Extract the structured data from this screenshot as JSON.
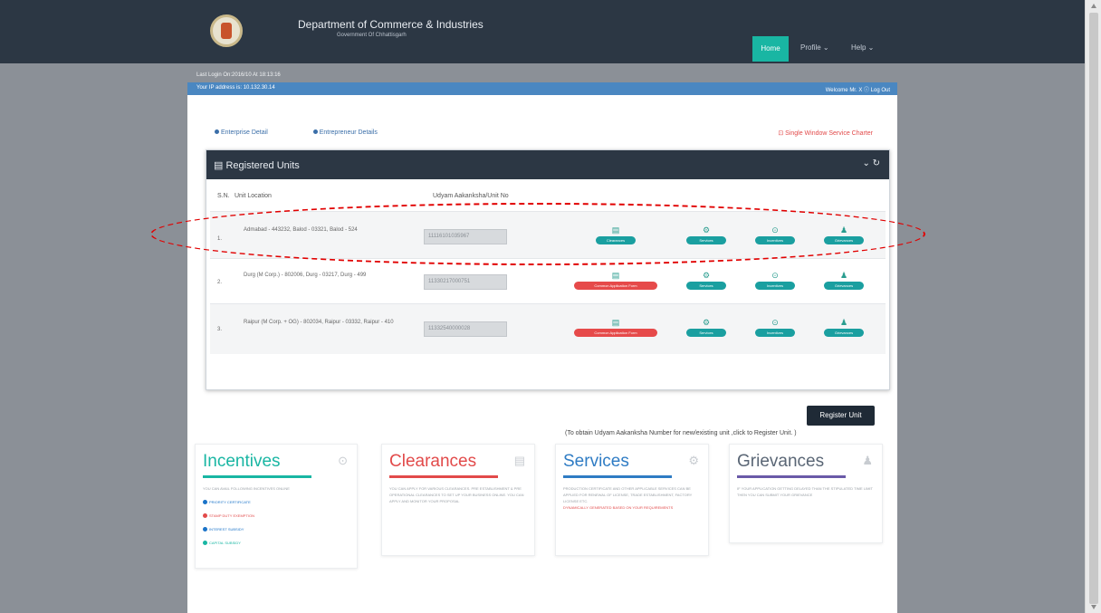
{
  "header": {
    "dept_title": "Department of Commerce & Industries",
    "dept_sub": "Government Of Chhattisgarh",
    "nav": {
      "home": "Home",
      "profile": "Profile ⌄",
      "help": "Help ⌄"
    }
  },
  "session": {
    "last_login": "Last Login On:2016/10 At 18:13:16",
    "ip": "Your IP address is: 10.132.30.14",
    "welcome": "Welcome Mr. X ⓘ Log Out"
  },
  "tabs": {
    "enterprise": "Enterprise Detail",
    "entrepreneur": "Entrepreneur Details",
    "charter": "Single Window Service Charter"
  },
  "units": {
    "heading": "Registered Units",
    "col_sn": "S.N.",
    "col_loc": "Unit Location",
    "col_udyam": "Udyam Aakanksha/Unit No",
    "rows": [
      {
        "sn": "1.",
        "location": "Admabad - 443232, Balod - 03321, Balod - 524",
        "udyam": "11116101035967",
        "act1": "Clearances",
        "act2": "Services",
        "act3": "Incentives",
        "act4": "Grievances"
      },
      {
        "sn": "2.",
        "location": "Durg (M Corp.) - 802006, Durg - 03217, Durg - 499",
        "udyam": "11330217000751",
        "act1": "Common Application Form",
        "act2": "Services",
        "act3": "Incentives",
        "act4": "Grievances"
      },
      {
        "sn": "3.",
        "location": "Raipur (M Corp. + OG) - 802034, Raipur - 03332, Raipur - 410",
        "udyam": "11332540000028",
        "act1": "Common Application Form",
        "act2": "Services",
        "act3": "Incentives",
        "act4": "Grievances"
      }
    ]
  },
  "register": {
    "button": "Register Unit",
    "note": "(To obtain Udyam Aakanksha Number for new/existing unit ,click to Register Unit. )"
  },
  "cards": {
    "incentives": {
      "title": "Incentives",
      "text": "YOU CAN AVAIL FOLLOWING INCENTIVES ONLINE",
      "links": [
        "PRIORITY CERTIFICATE",
        "STAMP DUTY EXEMPTION",
        "INTEREST SUBSIDY",
        "CAPITAL SUBSIDY"
      ]
    },
    "clearances": {
      "title": "Clearances",
      "text": "YOU CAN APPLY FOR VARIOUS CLEARANCES. PRE ESTABLISHMENT & PRE OPERATIONAL CLEARANCES TO SET UP YOUR BUSINESS ONLINE. YOU CAN APPLY AND MONITOR YOUR PROPOSAL"
    },
    "services": {
      "title": "Services",
      "text": "PRODUCTION CERTIFICATE AND OTHER APPLICABLE SERVICES CAN BE APPLIED FOR RENEWAL OF LICENSE, TRADE ESTABLISHMENT, FACTORY LICENSE ETC.",
      "highlight": "DYNAMICALLY GENERATED BASED ON YOUR REQUIREMENTS"
    },
    "grievances": {
      "title": "Grievances",
      "text": "IF YOUR APPLICATION GETTING DELAYED THAN THE STIPULATED TIME LIMIT THEN YOU CAN SUBMIT YOUR GRIEVANCE"
    }
  },
  "colors": {
    "header": "#2c3744",
    "accent": "#19b6a3",
    "bluebar": "#4a87c1",
    "red": "#e64a4a"
  }
}
